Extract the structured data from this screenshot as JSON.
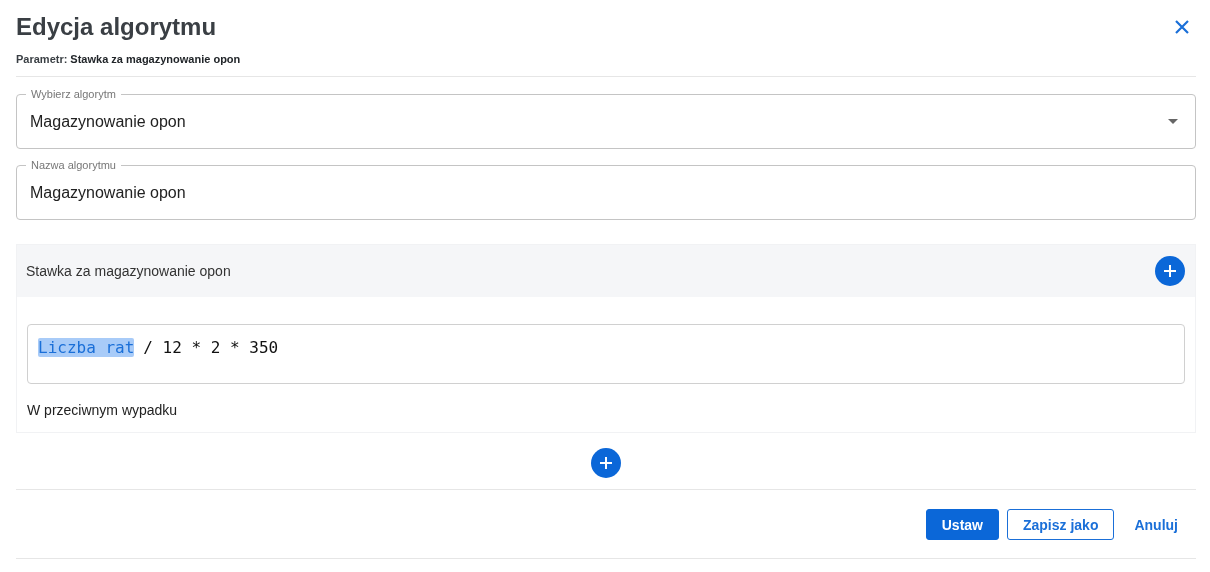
{
  "dialog": {
    "title": "Edycja algorytmu",
    "parameter_label": "Parametr:",
    "parameter_value": "Stawka za magazynowanie opon"
  },
  "select": {
    "label": "Wybierz algorytm",
    "value": "Magazynowanie opon"
  },
  "name_field": {
    "label": "Nazwa algorytmu",
    "value": "Magazynowanie opon"
  },
  "section": {
    "title": "Stawka za magazynowanie opon",
    "formula": [
      {
        "kind": "variable",
        "text": "Liczba rat"
      },
      {
        "kind": "text",
        "text": "/ 12 * 2 * 350"
      }
    ],
    "else_label": "W przeciwnym wypadku"
  },
  "buttons": [
    {
      "kind": "primary",
      "label": "Ustaw"
    },
    {
      "kind": "outline",
      "label": "Zapisz jako"
    },
    {
      "kind": "link",
      "label": "Anuluj"
    }
  ]
}
